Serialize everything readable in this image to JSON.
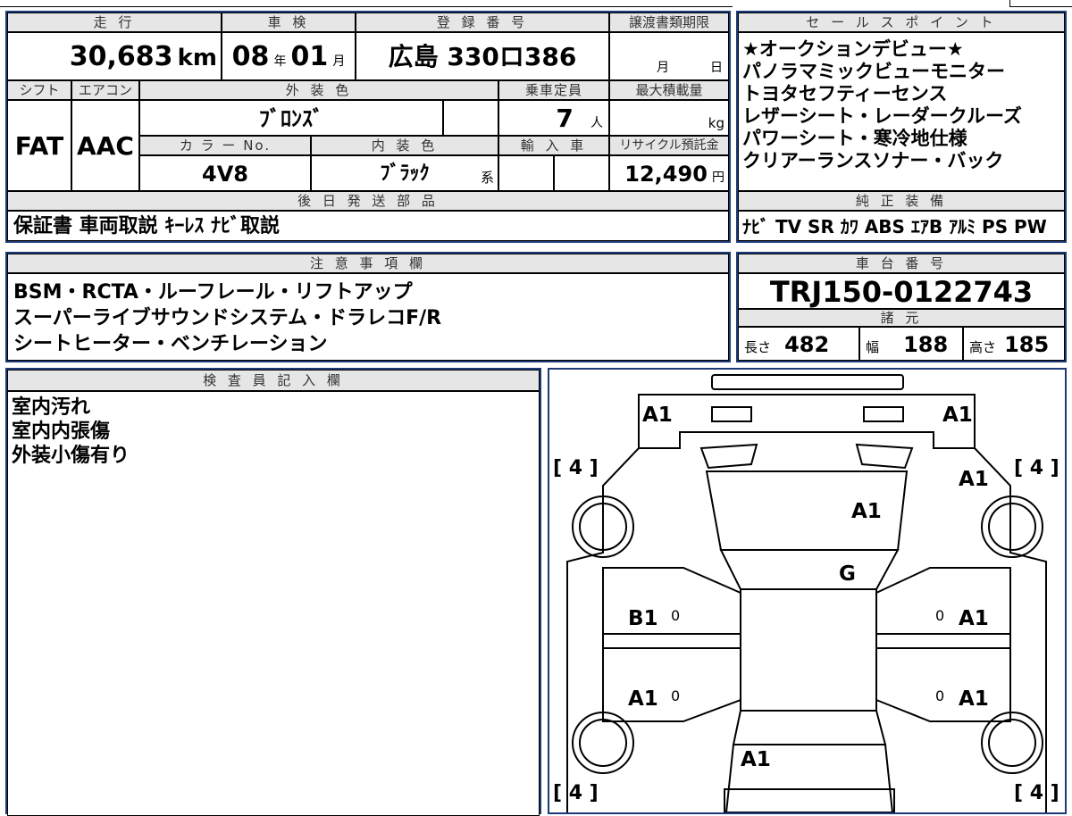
{
  "vehicle": {
    "mileage_label": "走 行",
    "mileage_value": "30,683",
    "mileage_unit": "km",
    "inspection_label": "車 検",
    "inspection_year": "08",
    "inspection_year_unit": "年",
    "inspection_month": "01",
    "inspection_month_unit": "月",
    "registration_label": "登 録 番 号",
    "registration_value": "広島 330ロ386",
    "transfer_label": "譲渡書類期限",
    "transfer_month_unit": "月",
    "transfer_day_unit": "日",
    "shift_label": "シフト",
    "shift_value": "FAT",
    "aircon_label": "エアコン",
    "aircon_value": "AAC",
    "exterior_color_label": "外 装 色",
    "exterior_color_value": "ﾌﾞﾛﾝｽﾞ",
    "capacity_label": "乗車定員",
    "capacity_value": "7",
    "capacity_unit": "人",
    "max_load_label": "最大積載量",
    "max_load_unit": "kg",
    "color_no_label": "カ ラ ー No.",
    "color_no_value": "4V8",
    "interior_color_label": "内 装 色",
    "interior_color_value": "ﾌﾞﾗｯｸ",
    "interior_color_suffix": "系",
    "import_label": "輸 入 車",
    "recycle_label": "リサイクル預託金",
    "recycle_value": "12,490",
    "recycle_unit": "円"
  },
  "later_parts": {
    "label": "後 日 発 送 部 品",
    "value": "保証書 車両取説 ｷｰﾚｽ ﾅﾋﾞ取説"
  },
  "sales_points": {
    "label": "セ ー ル ス ポ イ ン ト",
    "lines": [
      "★オークションデビュー★",
      "パノラマミックビューモニター",
      "トヨタセフティーセンス",
      "レザーシート・レーダークルーズ",
      "パワーシート・寒冷地仕様",
      "クリアーランスソナー・バック"
    ]
  },
  "equipment": {
    "label": "純 正 装 備",
    "value": "ﾅﾋﾞ TV SR ｶﾜ ABS ｴｱB ｱﾙﾐ PS PW"
  },
  "notes": {
    "label": "注 意 事 項 欄",
    "lines": [
      "BSM・RCTA・ルーフレール・リフトアップ",
      "スーパーライブサウンドシステム・ドラレコF/R",
      "シートヒーター・ベンチレーション"
    ]
  },
  "chassis": {
    "label": "車 台 番 号",
    "value": "TRJ150-0122743"
  },
  "specs": {
    "label": "諸 元",
    "length_label": "長さ",
    "length_value": "482",
    "width_label": "幅",
    "width_value": "188",
    "height_label": "高さ",
    "height_value": "185"
  },
  "inspector": {
    "label": "検 査 員 記 入 欄",
    "lines": [
      "室内汚れ",
      "室内内張傷",
      "外装小傷有り"
    ]
  },
  "diagram": {
    "tire_tl": "[ 4 ]",
    "tire_tr": "[ 4 ]",
    "tire_bl": "[ 4 ]",
    "tire_br": "[ 4 ]",
    "bumper_left": "A1",
    "bumper_right": "A1",
    "fender_right": "A1",
    "hood": "A1",
    "windshield": "G",
    "door_fl": "B1",
    "door_fr": "A1",
    "door_rl": "A1",
    "door_rr": "A1",
    "rear": "A1",
    "small_0": "0"
  }
}
